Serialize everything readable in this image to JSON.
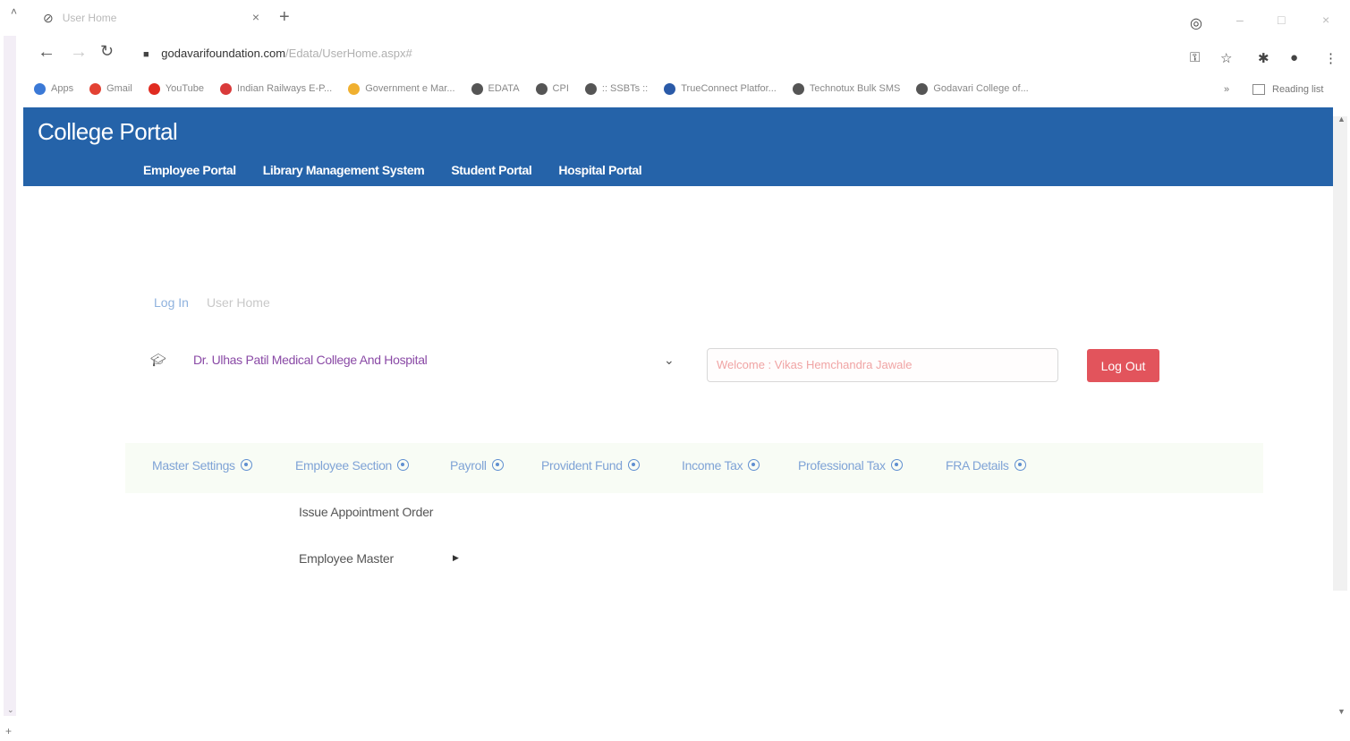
{
  "browser": {
    "tab_title": "User Home",
    "url_host": "godavarifoundation.com",
    "url_path": "/Edata/UserHome.aspx#",
    "bookmarks": [
      {
        "label": "Apps",
        "color": "#3b79d6"
      },
      {
        "label": "Gmail",
        "color": "#e34133"
      },
      {
        "label": "YouTube",
        "color": "#e02b20"
      },
      {
        "label": "Indian Railways E-P...",
        "color": "#d93a3a"
      },
      {
        "label": "Government e Mar...",
        "color": "#f0b030"
      },
      {
        "label": "EDATA",
        "color": "#555555"
      },
      {
        "label": "CPI",
        "color": "#555555"
      },
      {
        "label": ":: SSBTs ::",
        "color": "#555555"
      },
      {
        "label": "TrueConnect Platfor...",
        "color": "#2a5aa8"
      },
      {
        "label": "Technotux Bulk SMS",
        "color": "#555555"
      },
      {
        "label": "Godavari College of...",
        "color": "#555555"
      }
    ],
    "overflow": "»",
    "reading_list": "Reading list"
  },
  "header": {
    "brand": "College Portal",
    "nav": [
      "Employee Portal",
      "Library Management System",
      "Student Portal",
      "Hospital Portal"
    ]
  },
  "breadcrumb": {
    "link": "Log In",
    "current": "User Home"
  },
  "college": {
    "selected": "Dr. Ulhas Patil Medical College And Hospital"
  },
  "welcome": {
    "value": "Welcome : Vikas Hemchandra Jawale"
  },
  "logout_label": "Log Out",
  "menu": [
    "Master Settings",
    "Employee Section",
    "Payroll",
    "Provident Fund",
    "Income Tax",
    "Professional Tax",
    "FRA Details"
  ],
  "dropdown": [
    "Issue Appointment Order",
    "Employee Master"
  ],
  "colors": {
    "header_bg": "#2563a9",
    "logout_bg": "#e2545c",
    "menu_text": "#7fa3d6",
    "college_text": "#8a4aa6"
  }
}
